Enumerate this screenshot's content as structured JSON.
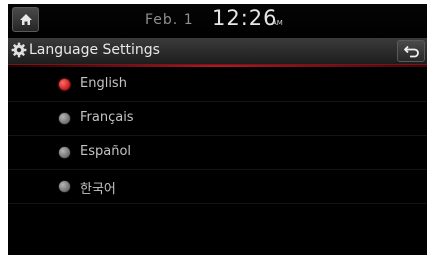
{
  "status_bar": {
    "home_icon": "home-icon",
    "date": "Feb. 1",
    "time": "12:26",
    "ampm": "AM"
  },
  "title_bar": {
    "icon": "gear-icon",
    "title": "Language Settings",
    "back_icon": "back-arrow-icon"
  },
  "languages": [
    {
      "label": "English",
      "selected": true
    },
    {
      "label": "Français",
      "selected": false
    },
    {
      "label": "Español",
      "selected": false
    },
    {
      "label": "한국어",
      "selected": false
    }
  ],
  "colors": {
    "selected_radio": "#d42a2a",
    "unselected_radio": "#8a8a8a",
    "accent_line": "#b5161e"
  }
}
